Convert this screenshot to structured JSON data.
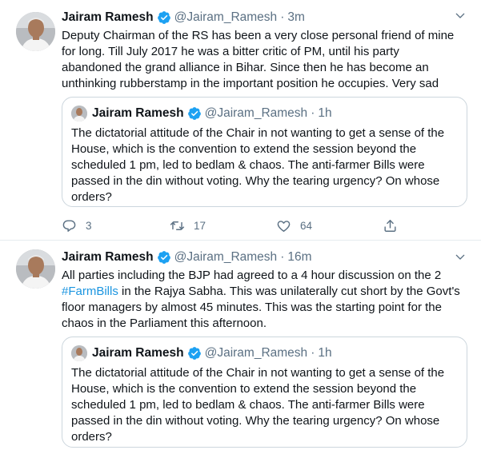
{
  "tweets": [
    {
      "author": {
        "name": "Jairam Ramesh",
        "handle": "@Jairam_Ramesh",
        "separator": "·",
        "time": "3m"
      },
      "text_lines": [
        "Deputy Chairman of the RS has been a very close personal friend of mine",
        "for long. Till July 2017 he was a bitter critic of PM, until his party",
        "abandoned the grand alliance in Bihar. Since then he has become an",
        "unthinking rubberstamp in the important position he occupies. Very sad"
      ],
      "quoted": {
        "name": "Jairam Ramesh",
        "handle": "@Jairam_Ramesh",
        "separator": "·",
        "time": "1h",
        "text_lines": [
          "The dictatorial attitude of the Chair in not wanting to get a sense of the",
          "House, which is the convention to extend the session beyond the",
          "scheduled 1 pm, led to bedlam & chaos. The anti-farmer Bills were",
          "passed in the din without voting. Why the tearing urgency? On whose",
          "orders?"
        ]
      },
      "actions": {
        "replies": "3",
        "retweets": "17",
        "likes": "64"
      }
    },
    {
      "author": {
        "name": "Jairam Ramesh",
        "handle": "@Jairam_Ramesh",
        "separator": "·",
        "time": "16m"
      },
      "text_line1": "All parties including the BJP had agreed to a 4 hour discussion on the 2",
      "hashtag": "#FarmBills",
      "text_line2_rest": " in the Rajya Sabha. This was unilaterally cut short by the Govt's",
      "text_line3": "floor managers by almost 45 minutes. This was the starting point for the",
      "text_line4": "chaos in the Parliament this afternoon.",
      "quoted": {
        "name": "Jairam Ramesh",
        "handle": "@Jairam_Ramesh",
        "separator": "·",
        "time": "1h",
        "text_lines": [
          "The dictatorial attitude of the Chair in not wanting to get a sense of the",
          "House, which is the convention to extend the session beyond the",
          "scheduled 1 pm, led to bedlam & chaos. The anti-farmer Bills were",
          "passed in the din without voting. Why the tearing urgency? On whose",
          "orders?"
        ]
      }
    }
  ],
  "icons": {
    "verified": "verified-badge-icon",
    "caret": "chevron-down-icon",
    "reply": "reply-icon",
    "retweet": "retweet-icon",
    "like": "heart-icon",
    "share": "share-icon"
  },
  "colors": {
    "accent": "#1da1f2",
    "hashtag": "#1b95e0",
    "secondary_text": "#5b7083",
    "border": "#ccd6dd"
  }
}
